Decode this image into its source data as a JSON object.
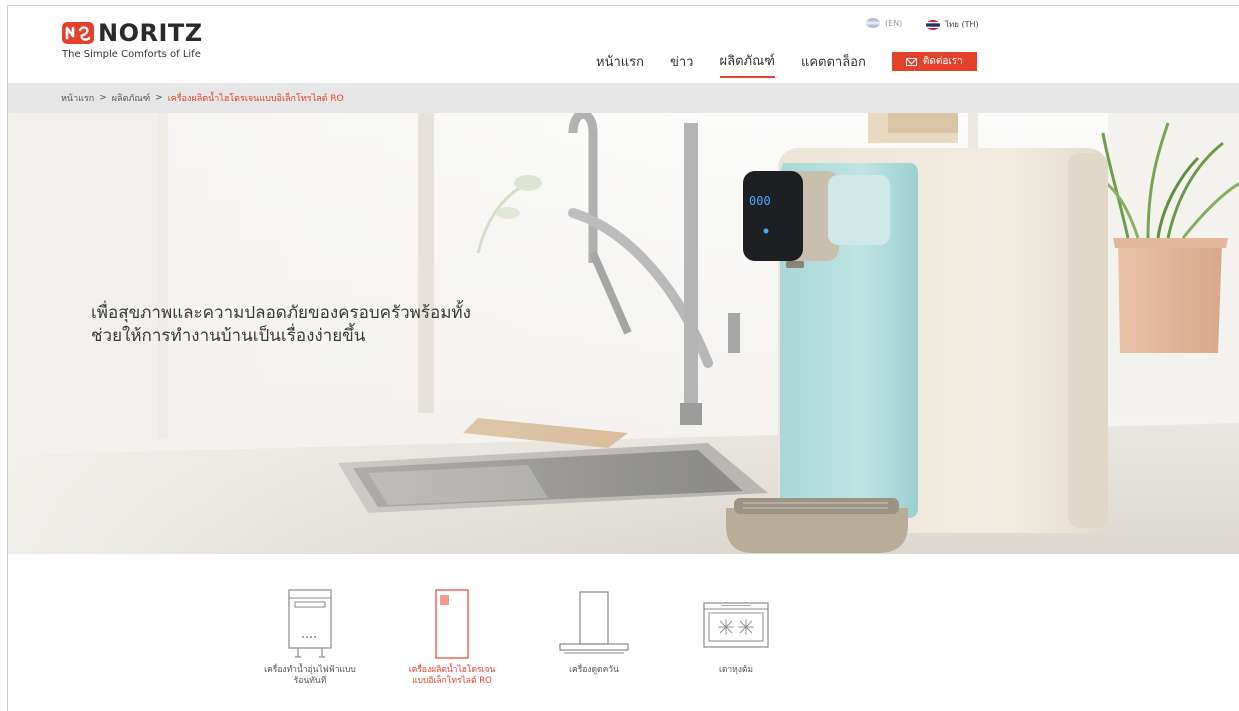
{
  "brand": {
    "name": "NORITZ",
    "tagline": "The Simple Comforts of Life",
    "accent_color": "#e4412c"
  },
  "language": {
    "en_label": "(EN)",
    "th_label": "ไทย (TH)"
  },
  "nav": {
    "items": [
      {
        "label": "หน้าแรก",
        "active": false
      },
      {
        "label": "ข่าว",
        "active": false
      },
      {
        "label": "ผลิตภัณฑ์",
        "active": true
      },
      {
        "label": "แคตตาล็อก",
        "active": false
      }
    ],
    "contact_label": "ติดต่อเรา",
    "contact_icon": "mail-icon"
  },
  "breadcrumb": {
    "items": [
      "หน้าแรก",
      "ผลิตภัณฑ์"
    ],
    "separator": ">",
    "current": "เครื่องผลิตน้ำไฮโดรเจนแบบอิเล็กโทรไลต์ RO"
  },
  "hero": {
    "line1": "เพื่อสุขภาพและความปลอดภัยของครอบครัวพร้อมทั้ง",
    "line2": "ช่วยให้การทำงานบ้านเป็นเรื่องง่ายขึ้น",
    "display_reading": "000"
  },
  "products": [
    {
      "line1": "เครื่องทำน้ำอุ่นไฟฟ้าแบบ",
      "line2": "ร้อนทันที",
      "icon": "water-heater-icon",
      "active": false
    },
    {
      "line1": "เครื่องผลิตน้ำไฮโดรเจน",
      "line2": "แบบอิเล็กโทรไลต์ RO",
      "icon": "hydrogen-water-icon",
      "active": true
    },
    {
      "line1": "เครื่องดูดควัน",
      "line2": "",
      "icon": "range-hood-icon",
      "active": false
    },
    {
      "line1": "เตาหุงต้ม",
      "line2": "",
      "icon": "stove-icon",
      "active": false
    }
  ]
}
